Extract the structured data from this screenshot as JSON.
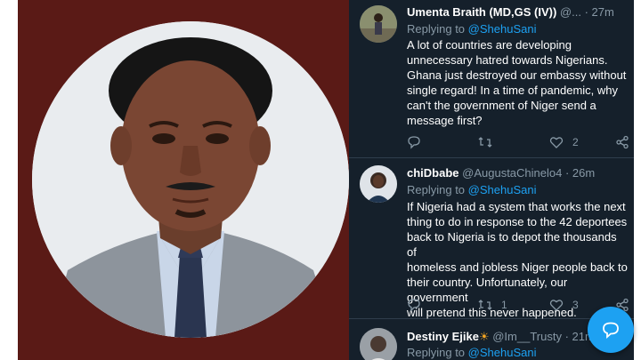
{
  "tweets": [
    {
      "name": "Umenta Braith (MD,GS (IV))",
      "handle": "@...",
      "time": "· 27m",
      "replying_to": "Replying to",
      "mention": "@ShehuSani",
      "lines": [
        "A lot of countries are developing",
        "unnecessary hatred towards Nigerians.",
        "Ghana just  destroyed our embassy without",
        "single regard! In a time of pandemic, why",
        "can't the government of Niger send a",
        "message first?"
      ],
      "replies": "",
      "retweets": "",
      "likes": "2"
    },
    {
      "name": "chiDbabe",
      "handle": "@AugustaChinelo4",
      "time": "· 26m",
      "replying_to": "Replying to",
      "mention": "@ShehuSani",
      "lines": [
        "If Nigeria had a system that works the next",
        "thing to do in response to the 42 deportees",
        "back to Nigeria is to depot the thousands of",
        "homeless and jobless Niger people back to",
        "their country. Unfortunately, our government",
        "will pretend this never happened."
      ],
      "replies": "",
      "retweets": "1",
      "likes": "3"
    },
    {
      "name": "Destiny Ejike",
      "badge": "☀",
      "handle": "@Im__Trusty",
      "time": "· 21m",
      "replying_to": "Replying to",
      "mention": "@ShehuSani"
    }
  ],
  "icons": [
    "reply-icon",
    "retweet-icon",
    "like-icon",
    "share-icon",
    "compose-icon"
  ],
  "colors": {
    "background": "#15202b",
    "accent": "#1da1f2",
    "muted": "#8899a6",
    "frame": "#5a1a16"
  }
}
